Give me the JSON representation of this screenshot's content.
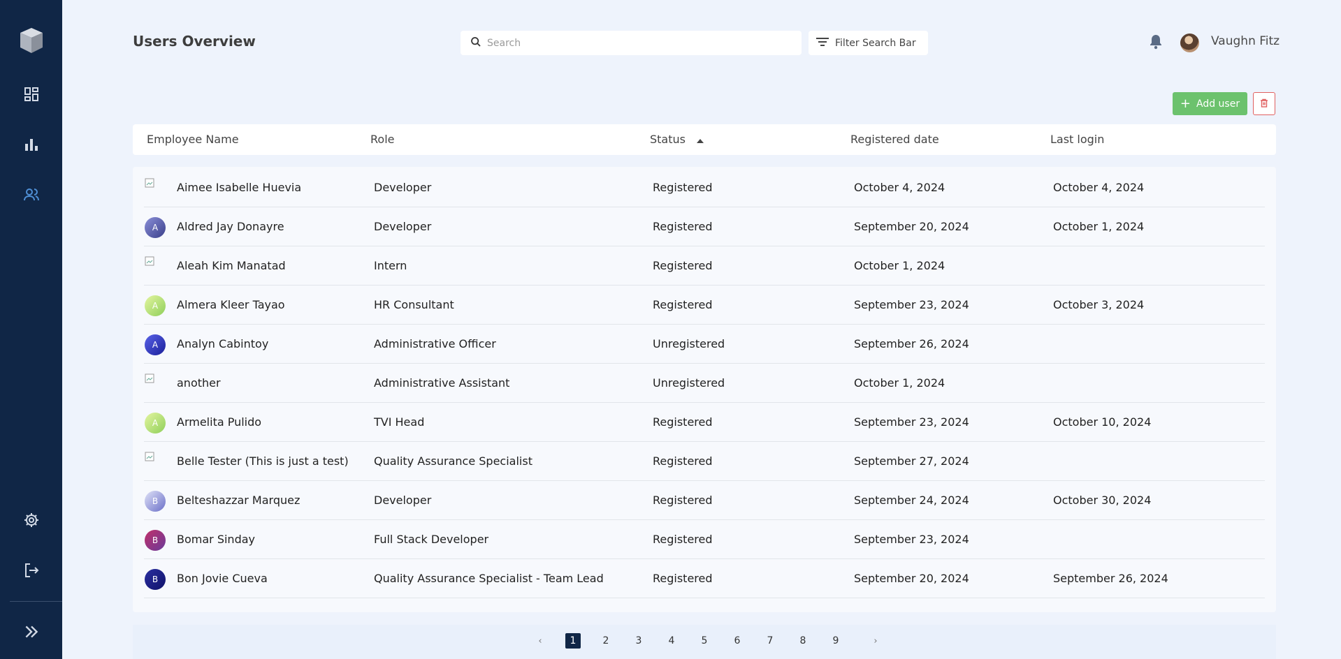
{
  "header": {
    "title": "Users Overview",
    "search_placeholder": "Search",
    "filter_label": "Filter Search Bar",
    "user_name": "Vaughn Fitz"
  },
  "actions": {
    "add_label": "Add user"
  },
  "colors": {
    "sidebar": "#102646",
    "accent_green": "#6cc26d",
    "active_nav": "#4f8fd6",
    "delete_red": "#e06060"
  },
  "sidebar": {
    "items": [
      {
        "name": "logo",
        "icon": "cube-logo-icon"
      },
      {
        "name": "dashboard",
        "icon": "dashboard-icon"
      },
      {
        "name": "analytics",
        "icon": "bar-chart-icon"
      },
      {
        "name": "users",
        "icon": "users-icon",
        "active": true
      },
      {
        "name": "settings",
        "icon": "gear-icon"
      },
      {
        "name": "logout",
        "icon": "logout-icon"
      },
      {
        "name": "expand",
        "icon": "double-chevron-right-icon"
      }
    ]
  },
  "table": {
    "columns": [
      "Employee Name",
      "Role",
      "Status",
      "Registered date",
      "Last login"
    ],
    "sorted_column": "Status",
    "sort_direction": "ascending",
    "rows": [
      {
        "name": "Aimee Isabelle Huevia",
        "initial": "",
        "broken_img": true,
        "role": "Developer",
        "status": "Registered",
        "registered": "October 4, 2024",
        "last_login": "October 4, 2024"
      },
      {
        "name": "Aldred Jay Donayre",
        "initial": "A",
        "avatar_bg": "linear-gradient(135deg,#8a8fd8,#3a3f8a)",
        "role": "Developer",
        "status": "Registered",
        "registered": "September 20, 2024",
        "last_login": "October 1, 2024"
      },
      {
        "name": "Aleah Kim Manatad",
        "initial": "",
        "broken_img": true,
        "role": "Intern",
        "status": "Registered",
        "registered": "October 1, 2024",
        "last_login": ""
      },
      {
        "name": "Almera Kleer Tayao",
        "initial": "A",
        "avatar_bg": "linear-gradient(135deg,#e4f5a0,#8fcf5a)",
        "role": "HR Consultant",
        "status": "Registered",
        "registered": "September 23, 2024",
        "last_login": "October 3, 2024"
      },
      {
        "name": "Analyn Cabintoy",
        "initial": "A",
        "avatar_bg": "linear-gradient(135deg,#5a63e8,#1a1f9a)",
        "role": "Administrative Officer",
        "status": "Unregistered",
        "registered": "September 26, 2024",
        "last_login": ""
      },
      {
        "name": "another",
        "initial": "",
        "broken_img": true,
        "role": "Administrative Assistant",
        "status": "Unregistered",
        "registered": "October 1, 2024",
        "last_login": ""
      },
      {
        "name": "Armelita Pulido",
        "initial": "A",
        "avatar_bg": "linear-gradient(135deg,#e4f5a0,#8fcf5a)",
        "role": "TVI Head",
        "status": "Registered",
        "registered": "September 23, 2024",
        "last_login": "October 10, 2024"
      },
      {
        "name": "Belle Tester (This is just a test)",
        "initial": "",
        "broken_img": true,
        "role": "Quality Assurance Specialist",
        "status": "Registered",
        "registered": "September 27, 2024",
        "last_login": ""
      },
      {
        "name": "Belteshazzar Marquez",
        "initial": "B",
        "avatar_bg": "linear-gradient(135deg,#e0e2f7,#6a6fc8)",
        "role": "Developer",
        "status": "Registered",
        "registered": "September 24, 2024",
        "last_login": "October 30, 2024"
      },
      {
        "name": "Bomar Sinday",
        "initial": "B",
        "avatar_bg": "linear-gradient(135deg,#c0306a,#6a3a9a)",
        "role": "Full Stack Developer",
        "status": "Registered",
        "registered": "September 23, 2024",
        "last_login": ""
      },
      {
        "name": "Bon Jovie Cueva",
        "initial": "B",
        "avatar_bg": "linear-gradient(135deg,#2a2fa0,#10126a)",
        "role": "Quality Assurance Specialist - Team Lead",
        "status": "Registered",
        "registered": "September 20, 2024",
        "last_login": "September 26, 2024"
      }
    ]
  },
  "pagination": {
    "current": 1,
    "pages": [
      "1",
      "2",
      "3",
      "4",
      "5",
      "6",
      "7",
      "8",
      "9"
    ],
    "prev_symbol": "‹",
    "next_symbol": "›"
  }
}
